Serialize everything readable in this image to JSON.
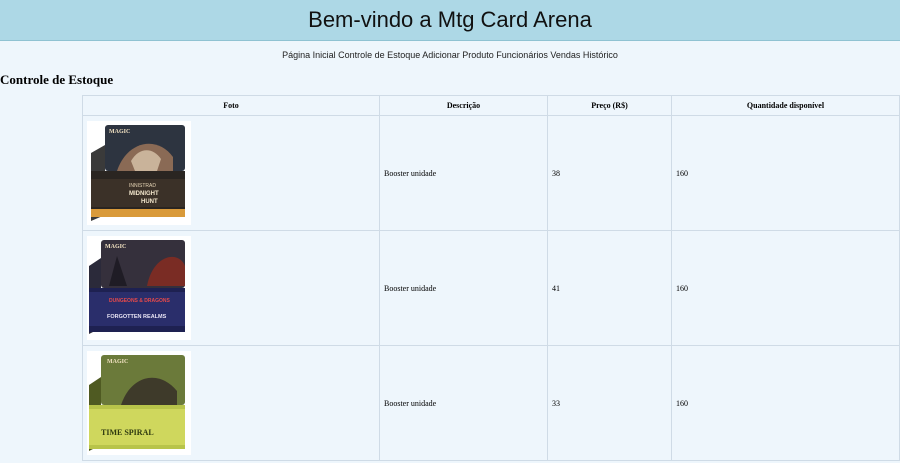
{
  "header": {
    "title": "Bem-vindo a Mtg Card Arena"
  },
  "nav": {
    "items": [
      {
        "label": "Página Inicial"
      },
      {
        "label": "Controle de Estoque"
      },
      {
        "label": "Adicionar Produto"
      },
      {
        "label": "Funcionários"
      },
      {
        "label": "Vendas"
      },
      {
        "label": "Histórico"
      }
    ]
  },
  "page": {
    "title": "Controle de Estoque"
  },
  "table": {
    "headers": [
      "Foto",
      "Descrição",
      "Preço (R$)",
      "Quantidade disponível"
    ],
    "rows": [
      {
        "image_text": [
          "MAGIC",
          "INNISTRAD",
          "MIDNIGHT",
          "HUNT"
        ],
        "descricao": "Booster unidade",
        "preco": "38",
        "quantidade": "160"
      },
      {
        "image_text": [
          "MAGIC",
          "DUNGEONS & DRAGONS",
          "FORGOTTEN REALMS"
        ],
        "descricao": "Booster unidade",
        "preco": "41",
        "quantidade": "160"
      },
      {
        "image_text": [
          "MAGIC",
          "TIME SPIRAL"
        ],
        "descricao": "Booster unidade",
        "preco": "33",
        "quantidade": "160"
      }
    ]
  },
  "colors": {
    "header_bg": "#add8e6",
    "page_bg": "#eef6fc",
    "border": "#cfdbe6"
  }
}
